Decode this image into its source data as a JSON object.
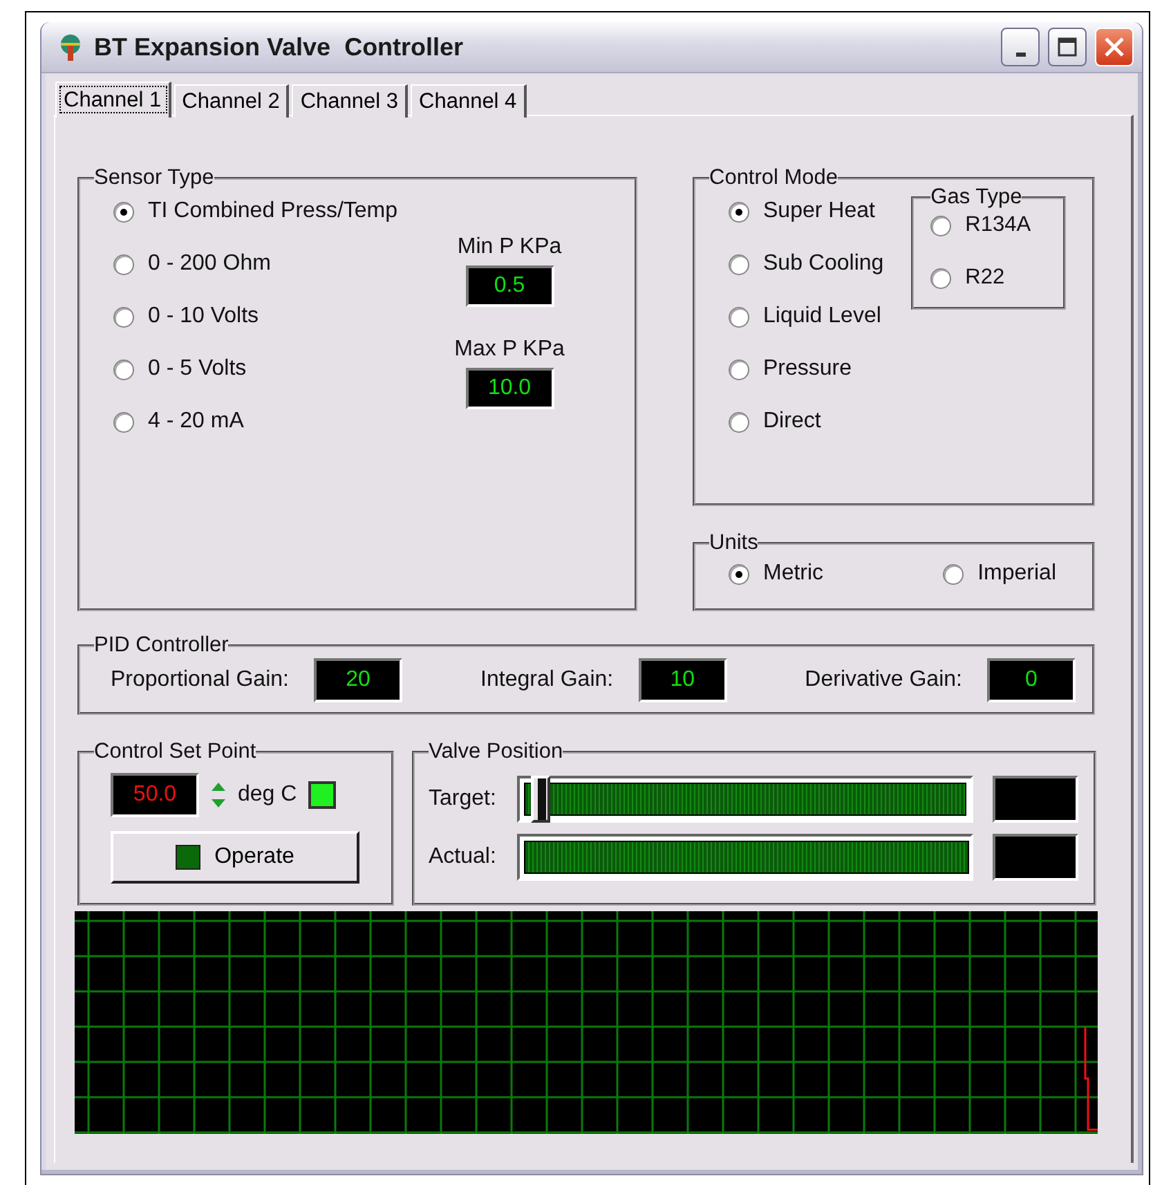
{
  "window": {
    "title": "BT Expansion Valve  Controller"
  },
  "tabs": [
    {
      "label": "Channel 1",
      "selected": true
    },
    {
      "label": "Channel 2",
      "selected": false
    },
    {
      "label": "Channel 3",
      "selected": false
    },
    {
      "label": "Channel 4",
      "selected": false
    }
  ],
  "sensor_type": {
    "label": "Sensor Type",
    "options": [
      {
        "label": "TI Combined Press/Temp",
        "selected": true
      },
      {
        "label": "0 - 200 Ohm",
        "selected": false
      },
      {
        "label": "0 - 10 Volts",
        "selected": false
      },
      {
        "label": "0 - 5 Volts",
        "selected": false
      },
      {
        "label": "4 - 20 mA",
        "selected": false
      }
    ],
    "min_p": {
      "label": "Min P KPa",
      "value": "0.5"
    },
    "max_p": {
      "label": "Max P KPa",
      "value": "10.0"
    }
  },
  "control_mode": {
    "label": "Control Mode",
    "options": [
      {
        "label": "Super Heat",
        "selected": true
      },
      {
        "label": "Sub Cooling",
        "selected": false
      },
      {
        "label": "Liquid Level",
        "selected": false
      },
      {
        "label": "Pressure",
        "selected": false
      },
      {
        "label": "Direct",
        "selected": false
      }
    ],
    "gas_type": {
      "label": "Gas Type",
      "options": [
        {
          "label": "R134A",
          "selected": false
        },
        {
          "label": "R22",
          "selected": false
        }
      ]
    }
  },
  "units": {
    "label": "Units",
    "options": [
      {
        "label": "Metric",
        "selected": true
      },
      {
        "label": "Imperial",
        "selected": false
      }
    ]
  },
  "pid_controller": {
    "label": "PID Controller",
    "fields": [
      {
        "label": "Proportional Gain:",
        "value": "20"
      },
      {
        "label": "Integral Gain:",
        "value": "10"
      },
      {
        "label": "Derivative Gain:",
        "value": "0"
      }
    ]
  },
  "control_set_point": {
    "label": "Control Set Point",
    "value": "50.0",
    "unit": "deg C",
    "indicator_on": true,
    "operate": {
      "label": "Operate",
      "led_on": false
    }
  },
  "valve_position": {
    "label": "Valve Position",
    "rows": [
      {
        "label": "Target:",
        "kind": "slider",
        "level": 0.03
      },
      {
        "label": "Actual:",
        "kind": "bar",
        "level": 1
      }
    ]
  }
}
